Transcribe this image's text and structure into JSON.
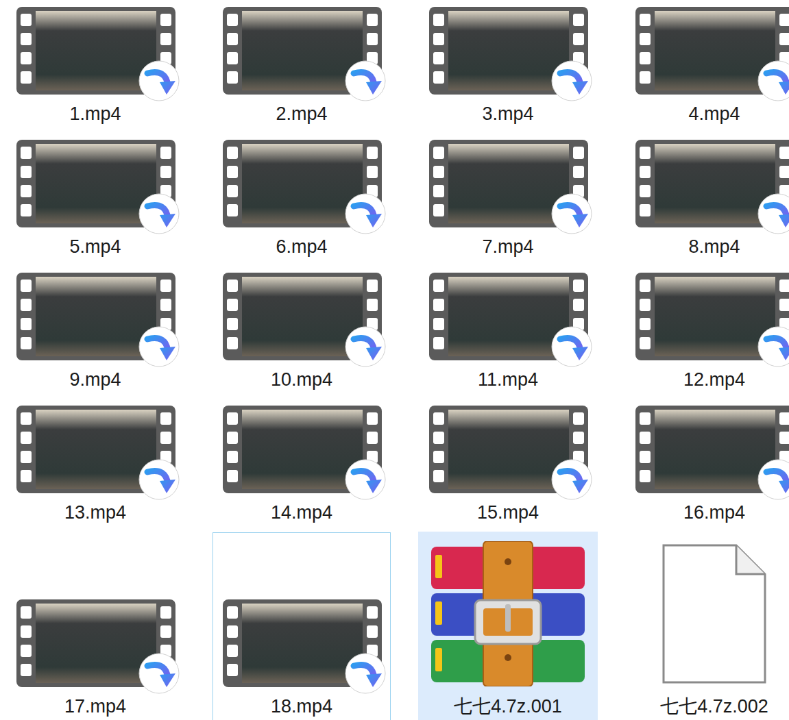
{
  "files": [
    {
      "name": "1.mp4",
      "kind": "video",
      "selected": false,
      "focused": false
    },
    {
      "name": "2.mp4",
      "kind": "video",
      "selected": false,
      "focused": false
    },
    {
      "name": "3.mp4",
      "kind": "video",
      "selected": false,
      "focused": false
    },
    {
      "name": "4.mp4",
      "kind": "video",
      "selected": false,
      "focused": false
    },
    {
      "name": "5.mp4",
      "kind": "video",
      "selected": false,
      "focused": false
    },
    {
      "name": "6.mp4",
      "kind": "video",
      "selected": false,
      "focused": false
    },
    {
      "name": "7.mp4",
      "kind": "video",
      "selected": false,
      "focused": false
    },
    {
      "name": "8.mp4",
      "kind": "video",
      "selected": false,
      "focused": false
    },
    {
      "name": "9.mp4",
      "kind": "video",
      "selected": false,
      "focused": false
    },
    {
      "name": "10.mp4",
      "kind": "video",
      "selected": false,
      "focused": false
    },
    {
      "name": "11.mp4",
      "kind": "video",
      "selected": false,
      "focused": false
    },
    {
      "name": "12.mp4",
      "kind": "video",
      "selected": false,
      "focused": false
    },
    {
      "name": "13.mp4",
      "kind": "video",
      "selected": false,
      "focused": false
    },
    {
      "name": "14.mp4",
      "kind": "video",
      "selected": false,
      "focused": false
    },
    {
      "name": "15.mp4",
      "kind": "video",
      "selected": false,
      "focused": false
    },
    {
      "name": "16.mp4",
      "kind": "video",
      "selected": false,
      "focused": false
    },
    {
      "name": "17.mp4",
      "kind": "video",
      "selected": false,
      "focused": false
    },
    {
      "name": "18.mp4",
      "kind": "video",
      "selected": false,
      "focused": true
    },
    {
      "name": "七七4.7z.001",
      "kind": "archive",
      "selected": true,
      "focused": false
    },
    {
      "name": "七七4.7z.002",
      "kind": "file",
      "selected": false,
      "focused": false
    }
  ]
}
